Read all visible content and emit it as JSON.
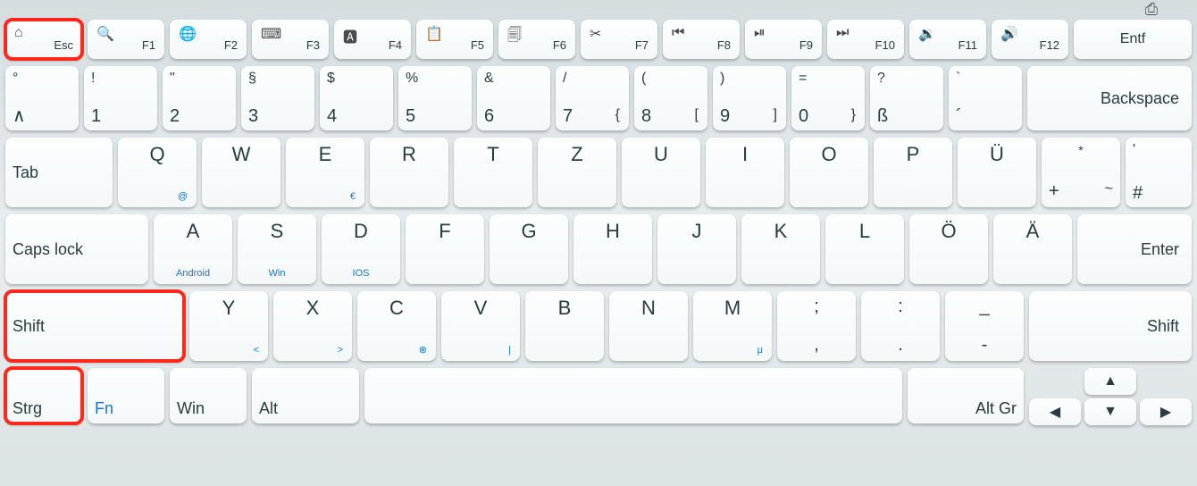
{
  "print_icon": "⎙",
  "row1": {
    "esc": {
      "icon": "⌂",
      "label": "Esc"
    },
    "f": [
      {
        "icon": "🔍",
        "label": "F1"
      },
      {
        "icon": "🌐",
        "label": "F2"
      },
      {
        "icon": "⌨",
        "label": "F3"
      },
      {
        "icon": "🅰",
        "label": "F4"
      },
      {
        "icon": "📋",
        "label": "F5"
      },
      {
        "icon": "🗐",
        "label": "F6"
      },
      {
        "icon": "✂",
        "label": "F7"
      },
      {
        "icon": "⏮",
        "label": "F8"
      },
      {
        "icon": "⏯",
        "label": "F9"
      },
      {
        "icon": "⏭",
        "label": "F10"
      },
      {
        "icon": "🔉",
        "label": "F11"
      },
      {
        "icon": "🔊",
        "label": "F12"
      }
    ],
    "entf": "Entf"
  },
  "row2": [
    {
      "top": "°",
      "bottom": "∧"
    },
    {
      "top": "!",
      "bottom": "1"
    },
    {
      "top": "\"",
      "bottom": "2"
    },
    {
      "top": "§",
      "bottom": "3"
    },
    {
      "top": "$",
      "bottom": "4"
    },
    {
      "top": "%",
      "bottom": "5"
    },
    {
      "top": "&",
      "bottom": "6"
    },
    {
      "top": "/",
      "bottom": "7",
      "alt": "{"
    },
    {
      "top": "(",
      "bottom": "8",
      "alt": "["
    },
    {
      "top": ")",
      "bottom": "9",
      "alt": "]"
    },
    {
      "top": "=",
      "bottom": "0",
      "alt": "}"
    },
    {
      "top": "?",
      "bottom": "ß"
    },
    {
      "top": "`",
      "bottom": "´"
    }
  ],
  "backspace": "Backspace",
  "row3": {
    "tab": "Tab",
    "keys": [
      {
        "top": "Q",
        "sub": "@",
        "subpos": "r"
      },
      {
        "top": "W"
      },
      {
        "top": "E",
        "sub": "€",
        "subpos": "r"
      },
      {
        "top": "R"
      },
      {
        "top": "T"
      },
      {
        "top": "Z"
      },
      {
        "top": "U"
      },
      {
        "top": "I"
      },
      {
        "top": "O"
      },
      {
        "top": "P"
      },
      {
        "top": "Ü"
      }
    ],
    "plus": {
      "top": "*",
      "bottom": "+",
      "alt": "~"
    },
    "hash": {
      "top": "'",
      "bottom": "#"
    }
  },
  "row4": {
    "caps": "Caps lock",
    "keys": [
      {
        "top": "A",
        "sub": "Android",
        "subpos": "c"
      },
      {
        "top": "S",
        "sub": "Win",
        "subpos": "c"
      },
      {
        "top": "D",
        "sub": "IOS",
        "subpos": "c"
      },
      {
        "top": "F"
      },
      {
        "top": "G"
      },
      {
        "top": "H"
      },
      {
        "top": "J"
      },
      {
        "top": "K"
      },
      {
        "top": "L"
      },
      {
        "top": "Ö"
      },
      {
        "top": "Ä"
      }
    ],
    "enter": "Enter"
  },
  "row5": {
    "shift_l": "Shift",
    "keys": [
      {
        "top": "Y",
        "sub": "<",
        "subpos": "r"
      },
      {
        "top": "X",
        "sub": ">",
        "subpos": "r"
      },
      {
        "top": "C",
        "sub": "⊗",
        "subpos": "r"
      },
      {
        "top": "V",
        "sub": "|",
        "subpos": "r"
      },
      {
        "top": "B"
      },
      {
        "top": "N"
      },
      {
        "top": "M",
        "sub": "μ",
        "subpos": "r"
      }
    ],
    "punct": [
      {
        "top": ";",
        "bottom": ","
      },
      {
        "top": ":",
        "bottom": "."
      },
      {
        "top": "_",
        "bottom": "-"
      }
    ],
    "shift_r": "Shift"
  },
  "row6": {
    "strg": "Strg",
    "fn": "Fn",
    "win": "Win",
    "alt": "Alt",
    "altgr": "Alt Gr",
    "arrows": {
      "up": "▲",
      "left": "◀",
      "down": "▼",
      "right": "▶"
    }
  }
}
